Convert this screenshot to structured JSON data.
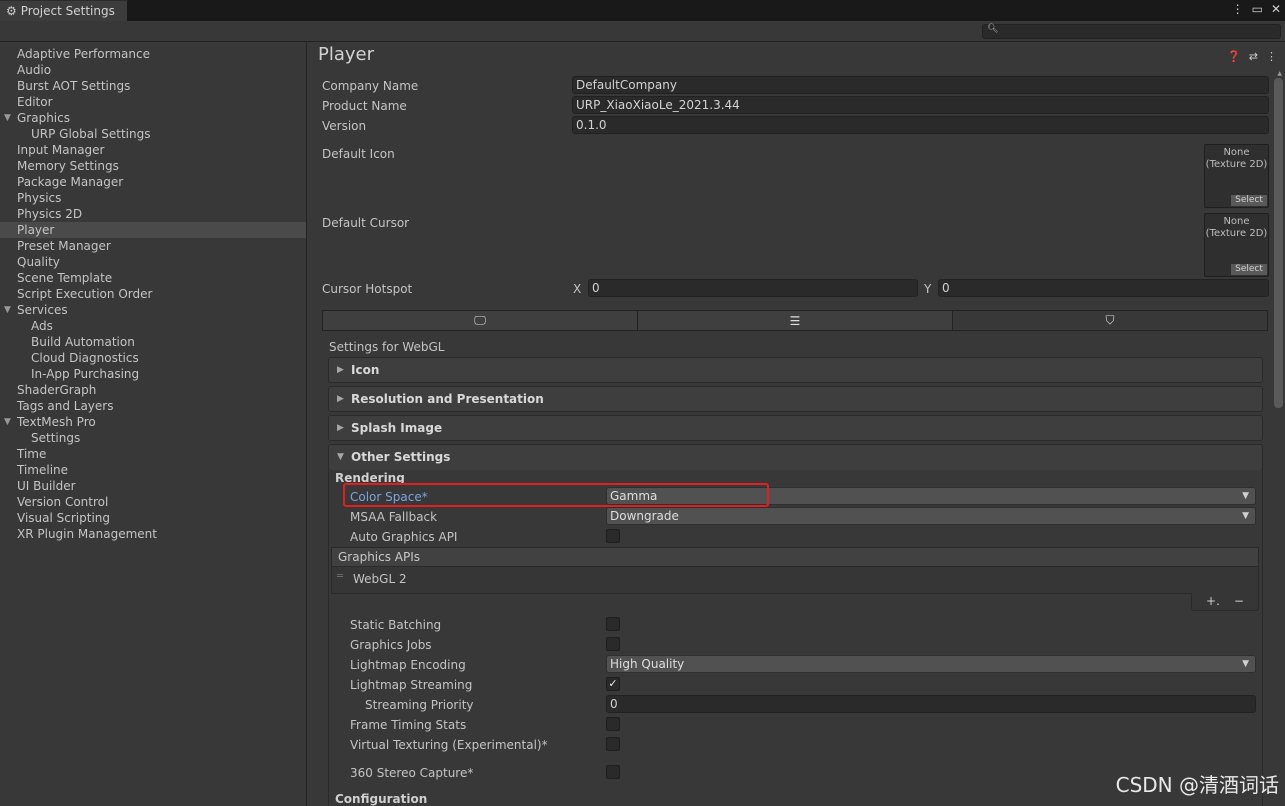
{
  "window": {
    "tab_title": "Project Settings",
    "menu_icon": "kebab-icon",
    "maximize_icon": "maximize-icon",
    "close_icon": "close-icon",
    "search_placeholder": ""
  },
  "sidebar": {
    "items": [
      {
        "label": "Adaptive Performance",
        "indent": 0
      },
      {
        "label": "Audio",
        "indent": 0
      },
      {
        "label": "Burst AOT Settings",
        "indent": 0
      },
      {
        "label": "Editor",
        "indent": 0
      },
      {
        "label": "Graphics",
        "indent": 0,
        "foldout": true
      },
      {
        "label": "URP Global Settings",
        "indent": 1
      },
      {
        "label": "Input Manager",
        "indent": 0
      },
      {
        "label": "Memory Settings",
        "indent": 0
      },
      {
        "label": "Package Manager",
        "indent": 0
      },
      {
        "label": "Physics",
        "indent": 0
      },
      {
        "label": "Physics 2D",
        "indent": 0
      },
      {
        "label": "Player",
        "indent": 0,
        "selected": true
      },
      {
        "label": "Preset Manager",
        "indent": 0
      },
      {
        "label": "Quality",
        "indent": 0
      },
      {
        "label": "Scene Template",
        "indent": 0
      },
      {
        "label": "Script Execution Order",
        "indent": 0
      },
      {
        "label": "Services",
        "indent": 0,
        "foldout": true
      },
      {
        "label": "Ads",
        "indent": 1
      },
      {
        "label": "Build Automation",
        "indent": 1
      },
      {
        "label": "Cloud Diagnostics",
        "indent": 1
      },
      {
        "label": "In-App Purchasing",
        "indent": 1
      },
      {
        "label": "ShaderGraph",
        "indent": 0
      },
      {
        "label": "Tags and Layers",
        "indent": 0
      },
      {
        "label": "TextMesh Pro",
        "indent": 0,
        "foldout": true
      },
      {
        "label": "Settings",
        "indent": 1
      },
      {
        "label": "Time",
        "indent": 0
      },
      {
        "label": "Timeline",
        "indent": 0
      },
      {
        "label": "UI Builder",
        "indent": 0
      },
      {
        "label": "Version Control",
        "indent": 0
      },
      {
        "label": "Visual Scripting",
        "indent": 0
      },
      {
        "label": "XR Plugin Management",
        "indent": 0
      }
    ]
  },
  "player": {
    "title": "Player",
    "company_name_label": "Company Name",
    "company_name": "DefaultCompany",
    "product_name_label": "Product Name",
    "product_name": "URP_XiaoXiaoLe_2021.3.44",
    "version_label": "Version",
    "version": "0.1.0",
    "default_icon_label": "Default Icon",
    "default_cursor_label": "Default Cursor",
    "object_none": "None",
    "object_type": "(Texture 2D)",
    "select_label": "Select",
    "cursor_hotspot_label": "Cursor Hotspot",
    "x_label": "X",
    "x_value": "0",
    "y_label": "Y",
    "y_value": "0",
    "settings_for": "Settings for WebGL"
  },
  "sections": {
    "icon": "Icon",
    "resolution": "Resolution and Presentation",
    "splash": "Splash Image",
    "other": "Other Settings"
  },
  "other": {
    "rendering_header": "Rendering",
    "color_space_label": "Color Space*",
    "color_space_value": "Gamma",
    "msaa_label": "MSAA Fallback",
    "msaa_value": "Downgrade",
    "auto_graphics_label": "Auto Graphics API",
    "auto_graphics_checked": false,
    "graphics_apis_label": "Graphics APIs",
    "graphics_api_item": "WebGL 2",
    "add_symbol": "+.",
    "remove_symbol": "−",
    "static_batching_label": "Static Batching",
    "graphics_jobs_label": "Graphics Jobs",
    "lightmap_encoding_label": "Lightmap Encoding",
    "lightmap_encoding_value": "High Quality",
    "lightmap_streaming_label": "Lightmap Streaming",
    "lightmap_streaming_checked": true,
    "streaming_priority_label": "Streaming Priority",
    "streaming_priority_value": "0",
    "frame_timing_label": "Frame Timing Stats",
    "virtual_texturing_label": "Virtual Texturing (Experimental)*",
    "stereo_capture_label": "360 Stereo Capture*",
    "configuration_header": "Configuration",
    "check_mark": "✓"
  },
  "watermark": "CSDN @清酒词话"
}
